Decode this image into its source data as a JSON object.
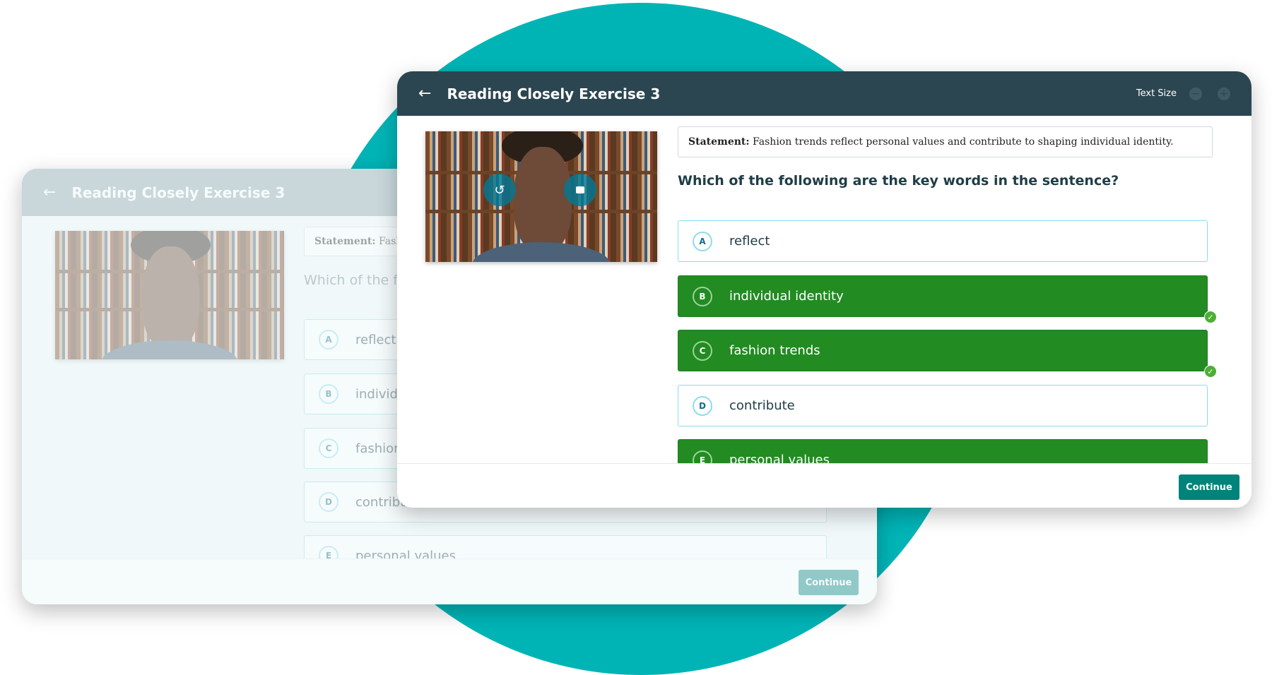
{
  "app": {
    "title": "Reading Closely Exercise 3",
    "text_size_label": "Text Size",
    "back_icon": "arrow-left-icon"
  },
  "statement": {
    "label": "Statement:",
    "text": "Fashion trends reflect personal values and contribute to shaping individual identity."
  },
  "question": "Which of the following are the key words in the sentence?",
  "options": [
    {
      "letter": "A",
      "label": "reflect",
      "selected": false
    },
    {
      "letter": "B",
      "label": "individual identity",
      "selected": true
    },
    {
      "letter": "C",
      "label": "fashion trends",
      "selected": true
    },
    {
      "letter": "D",
      "label": "contribute",
      "selected": false
    },
    {
      "letter": "E",
      "label": "personal values",
      "selected": true
    }
  ],
  "continue_label": "Continue",
  "video_controls": {
    "replay_icon": "replay-icon",
    "stop_icon": "stop-icon"
  },
  "colors": {
    "teal_circle": "#00b4b6",
    "header": "#2b4650",
    "selected": "#228b22",
    "continue": "#00837a"
  }
}
